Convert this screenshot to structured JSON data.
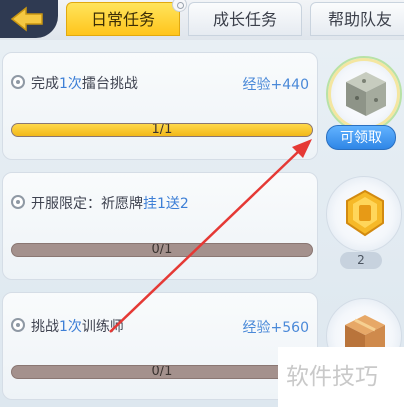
{
  "tabs": [
    {
      "label": "日常任务",
      "active": true
    },
    {
      "label": "成长任务",
      "active": false
    },
    {
      "label": "帮助队友",
      "active": false
    }
  ],
  "tasks": [
    {
      "title_pre": "完成",
      "title_hl": "1次",
      "title_post": "擂台挑战",
      "reward": "经验+440",
      "progress_text": "1/1",
      "progress": 1.0,
      "reward_icon": "stone-cube-icon",
      "action": "可领取"
    },
    {
      "title_pre": "开服限定：祈愿牌",
      "title_hl": "挂1送2",
      "title_post": "",
      "reward": "",
      "progress_text": "0/1",
      "progress": 0.0,
      "reward_icon": "golden-token-icon",
      "count": "2"
    },
    {
      "title_pre": "挑战",
      "title_hl": "1次",
      "title_post": "训练师",
      "reward": "经验+560",
      "progress_text": "0/1",
      "progress": 0.0,
      "reward_icon": "treasure-crate-icon"
    }
  ],
  "watermark": "软件技巧",
  "colors": {
    "accent": "#ffc51c",
    "highlight": "#3d7fd6",
    "button": "#2f86e6",
    "annotation": "#e53935"
  }
}
